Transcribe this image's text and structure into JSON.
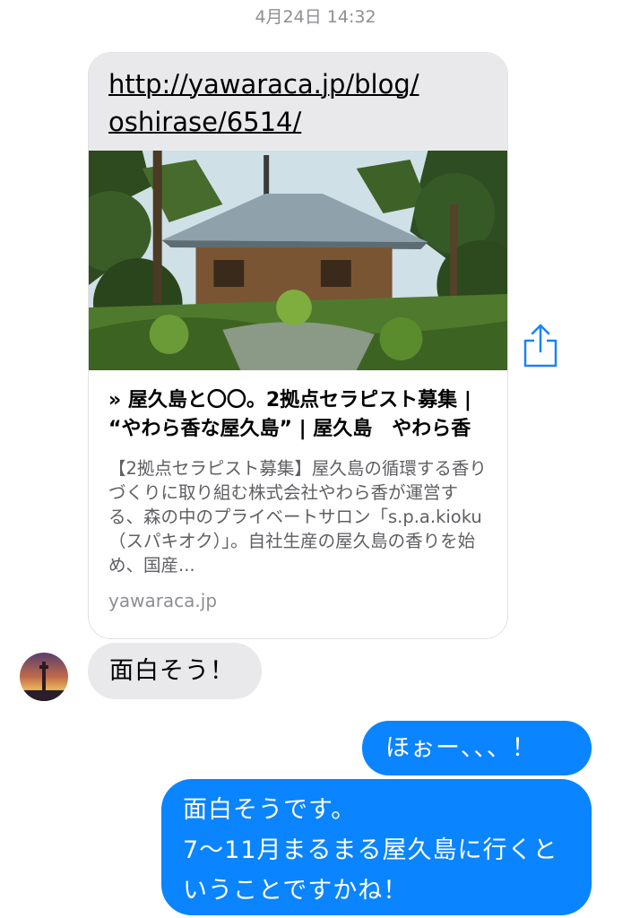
{
  "conversation": {
    "timestamp": "4月24日 14:32"
  },
  "link_preview": {
    "url_line1": "http://yawaraca.jp/blog/",
    "url_line2": "oshirase/6514/",
    "title": "» 屋久島と〇〇。2拠点セラピスト募集 | “やわら香な屋久島” | 屋久島　やわら香",
    "description": "【2拠点セラピスト募集】屋久島の循環する香りづくりに取り組む株式会社やわら香が運営する、森の中のプライベートサロン「s.p.a.kioku（スパキオク）」。自社生産の屋久島の香りを始め、国産...",
    "domain": "yawaraca.jp",
    "image_icon": "wooden-cabin-in-forest-image"
  },
  "share_button": {
    "icon": "share-icon",
    "color": "#1a82f7"
  },
  "messages": {
    "incoming": [
      {
        "text": "面白そう！"
      }
    ],
    "outgoing": [
      {
        "text": "ほぉー、、、！"
      },
      {
        "line1": "面白そうです。",
        "line2": "7〜11月まるまる屋久島に行くと",
        "line3": "いうことですかね！"
      }
    ]
  },
  "colors": {
    "outgoing_bubble": "#0a84ff",
    "incoming_bubble": "#e9e9eb",
    "timestamp": "#8e8e93"
  }
}
